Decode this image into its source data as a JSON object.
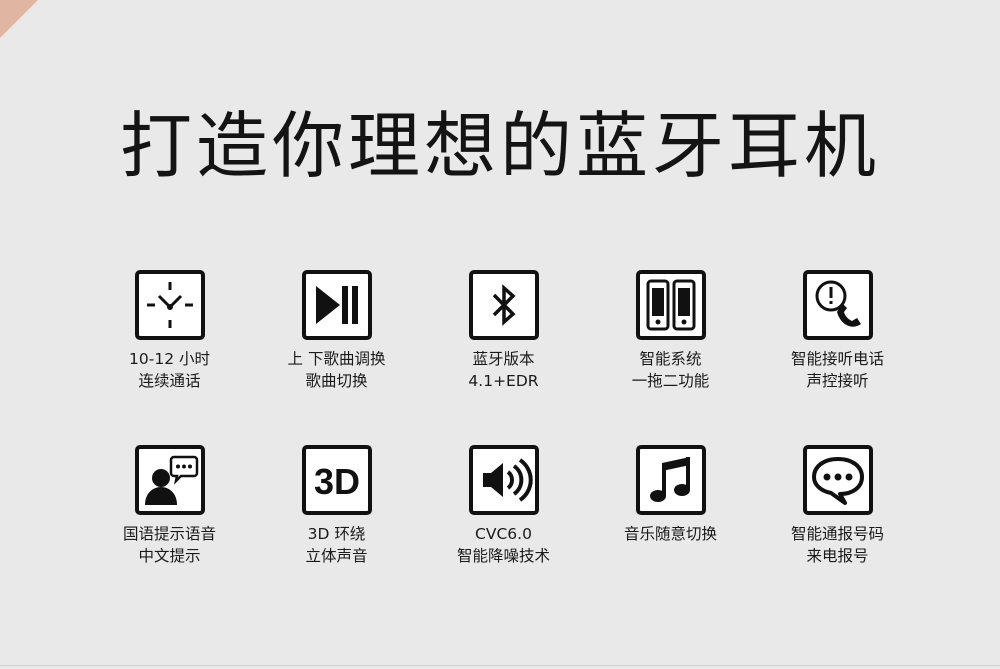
{
  "title": "打造你理想的蓝牙耳机",
  "features": [
    {
      "icon": "clock-icon",
      "line1": "10-12 小时",
      "line2": "连续通话"
    },
    {
      "icon": "play-pause-icon",
      "line1": "上 下歌曲调换",
      "line2": "歌曲切换"
    },
    {
      "icon": "bluetooth-icon",
      "line1": "蓝牙版本",
      "line2": "4.1+EDR"
    },
    {
      "icon": "dual-phone-icon",
      "line1": "智能系统",
      "line2": "一拖二功能"
    },
    {
      "icon": "phone-alert-icon",
      "line1": "智能接听电话",
      "line2": "声控接听"
    },
    {
      "icon": "voice-prompt-icon",
      "line1": "国语提示语音",
      "line2": "中文提示"
    },
    {
      "icon": "3d-icon",
      "line1": "3D 环绕",
      "line2": "立体声音",
      "icon_text": "3D"
    },
    {
      "icon": "speaker-icon",
      "line1": "CVC6.0",
      "line2": "智能降噪技术"
    },
    {
      "icon": "music-note-icon",
      "line1": "音乐随意切换",
      "line2": ""
    },
    {
      "icon": "chat-bubble-icon",
      "line1": "智能通报号码",
      "line2": "来电报号"
    }
  ]
}
